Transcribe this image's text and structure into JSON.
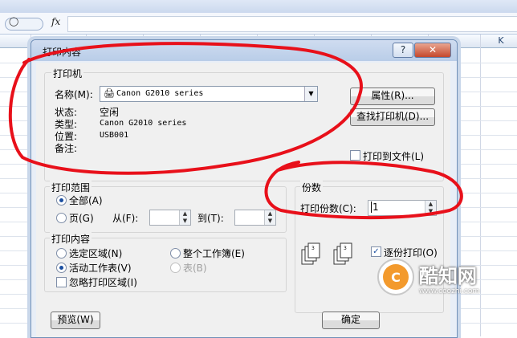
{
  "excel": {
    "namebox": "◯",
    "fx": "fx",
    "columns": [
      "C",
      "D",
      "E",
      "F",
      "G",
      "H",
      "I",
      "J",
      "K"
    ]
  },
  "dialog": {
    "title": "打印内容",
    "help": "?",
    "close": "✕",
    "printer": {
      "group_label": "打印机",
      "name_label": "名称(M):",
      "name_value": "Canon G2010 series",
      "status_label": "状态:",
      "status_value": "空闲",
      "type_label": "类型:",
      "type_value": "Canon G2010 series",
      "location_label": "位置:",
      "location_value": "USB001",
      "comment_label": "备注:",
      "properties_button": "属性(R)...",
      "find_button": "查找打印机(D)...",
      "print_to_file": "打印到文件(L)"
    },
    "range": {
      "group_label": "打印范围",
      "all": "全部(A)",
      "pages": "页(G)",
      "from": "从(F):",
      "to": "到(T):",
      "from_value": "",
      "to_value": ""
    },
    "copies": {
      "group_label": "份数",
      "count_label": "打印份数(C):",
      "count_value": "1",
      "collate": "逐份打印(O)"
    },
    "content": {
      "group_label": "打印内容",
      "selection": "选定区域(N)",
      "whole_workbook": "整个工作簿(E)",
      "active_sheets": "活动工作表(V)",
      "table": "表(B)",
      "ignore_print_areas": "忽略打印区域(I)"
    },
    "preview_button": "预览(W)",
    "ok_button": "确定"
  },
  "watermark": {
    "brand": "酷知网",
    "url": "www.coozhi.com"
  },
  "colors": {
    "annotation": "#e8101a",
    "dialog_bg": "#f0f0f0",
    "titlebar": "#bcd0ea"
  }
}
